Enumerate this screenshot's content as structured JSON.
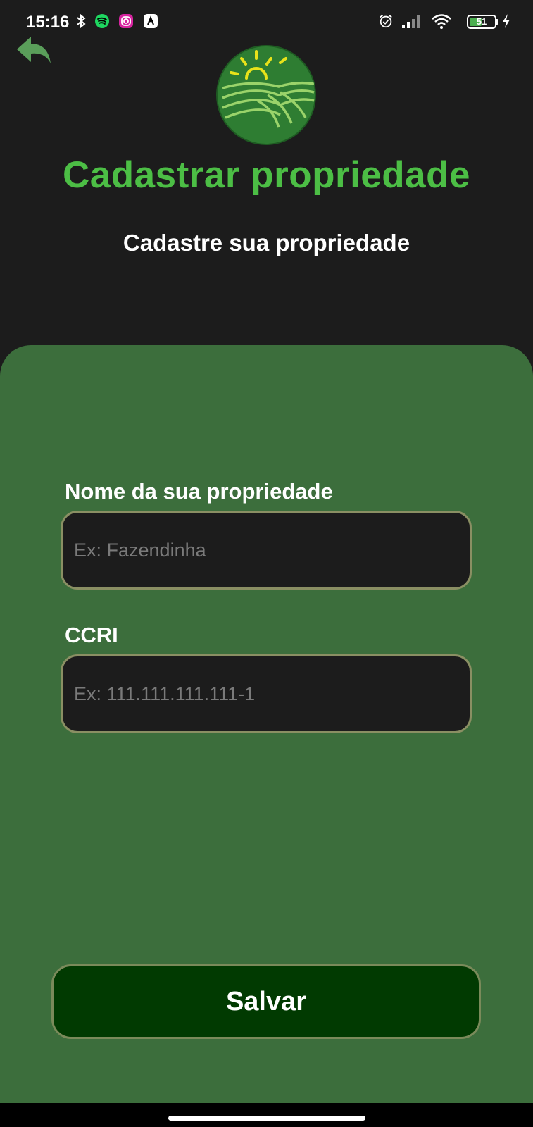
{
  "status_bar": {
    "time": "15:16",
    "battery_level": "51",
    "battery_fraction": 0.51,
    "left_icons": [
      "bluetooth-icon",
      "spotify-icon",
      "instagram-icon",
      "app-icon"
    ],
    "right_icons": [
      "alarm-icon",
      "signal-icon",
      "wifi-icon",
      "battery-icon",
      "charging-icon"
    ]
  },
  "header": {
    "back_icon": "back-arrow-icon",
    "logo_icon": "farm-sun-logo",
    "title": "Cadastrar propriedade",
    "subtitle": "Cadastre sua propriedade"
  },
  "form": {
    "property_name": {
      "label": "Nome da sua propriedade",
      "placeholder": "Ex: Fazendinha",
      "value": ""
    },
    "ccri": {
      "label": "CCRI",
      "placeholder": "Ex: 111.111.111.111-1",
      "value": ""
    },
    "save_label": "Salvar"
  },
  "colors": {
    "background": "#1c1c1c",
    "title_green": "#4cbe45",
    "panel_green": "#3c6e3c",
    "button_green": "#013a01",
    "input_border": "#8a8f63",
    "logo_green": "#2e7d32",
    "sun_yellow": "#e8e21a"
  }
}
